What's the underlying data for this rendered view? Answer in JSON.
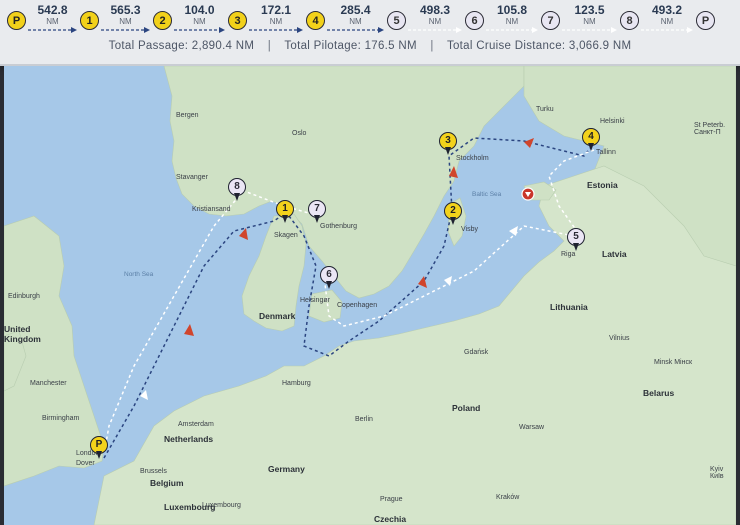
{
  "itinerary": {
    "stops": [
      {
        "label": "P",
        "kind": "pilot"
      },
      {
        "label": "1",
        "kind": "pilot"
      },
      {
        "label": "2",
        "kind": "pilot"
      },
      {
        "label": "3",
        "kind": "pilot"
      },
      {
        "label": "4",
        "kind": "pilot"
      },
      {
        "label": "5",
        "kind": "cruise"
      },
      {
        "label": "6",
        "kind": "cruise"
      },
      {
        "label": "7",
        "kind": "cruise"
      },
      {
        "label": "8",
        "kind": "cruise"
      },
      {
        "label": "P",
        "kind": "cruise"
      }
    ],
    "legs": [
      {
        "distance": "542.8",
        "unit": "NM",
        "kind": "pilotage"
      },
      {
        "distance": "565.3",
        "unit": "NM",
        "kind": "pilotage"
      },
      {
        "distance": "104.0",
        "unit": "NM",
        "kind": "pilotage"
      },
      {
        "distance": "172.1",
        "unit": "NM",
        "kind": "pilotage"
      },
      {
        "distance": "285.4",
        "unit": "NM",
        "kind": "pilotage"
      },
      {
        "distance": "498.3",
        "unit": "NM",
        "kind": "cruise"
      },
      {
        "distance": "105.8",
        "unit": "NM",
        "kind": "cruise"
      },
      {
        "distance": "123.5",
        "unit": "NM",
        "kind": "cruise"
      },
      {
        "distance": "493.2",
        "unit": "NM",
        "kind": "cruise"
      }
    ]
  },
  "totals": {
    "passage": "Total Passage: 2,890.4 NM",
    "pilotage": "Total Pilotage: 176.5 NM",
    "cruise": "Total Cruise Distance: 3,066.9 NM",
    "separator": "|"
  },
  "colors": {
    "pilot_accent": "#f3d21b",
    "cruise_accent": "#ebe6f5",
    "route_dark": "#2b4580",
    "route_light": "#ffffff",
    "sea": "#a6c8e8",
    "land": "#cfe1c5",
    "direction_marker": "#d0452c"
  },
  "map": {
    "markers": [
      {
        "label": "P",
        "kind": "pilot",
        "name": "Dover"
      },
      {
        "label": "1",
        "kind": "pilot",
        "name": "Skagen"
      },
      {
        "label": "2",
        "kind": "pilot",
        "name": "Visby"
      },
      {
        "label": "3",
        "kind": "pilot",
        "name": "Stockholm"
      },
      {
        "label": "4",
        "kind": "pilot",
        "name": "Tallinn"
      },
      {
        "label": "5",
        "kind": "cruise",
        "name": "Riga"
      },
      {
        "label": "6",
        "kind": "cruise",
        "name": "Copenhagen"
      },
      {
        "label": "7",
        "kind": "cruise",
        "name": "Gothenburg"
      },
      {
        "label": "8",
        "kind": "cruise",
        "name": "Kristiansand"
      }
    ],
    "countries": [
      "Denmark",
      "Estonia",
      "Latvia",
      "Lithuania",
      "Poland",
      "Belarus",
      "Germany",
      "Netherlands",
      "Belgium",
      "Luxembourg",
      "Czechia",
      "United Kingdom"
    ],
    "cities": [
      "Bergen",
      "Oslo",
      "Turku",
      "Helsinki",
      "St Peterb. Санкт-П",
      "Stavanger",
      "Kristiansand",
      "Skagen",
      "Gothenburg",
      "Stockholm",
      "Tallinn",
      "Visby",
      "Riga",
      "Helsingør",
      "Copenhagen",
      "Edinburgh",
      "Manchester",
      "Birmingham",
      "London",
      "Dover",
      "Amsterdam",
      "Brussels",
      "Hamburg",
      "Berlin",
      "Gdańsk",
      "Vilnius",
      "Minsk Мінск",
      "Warsaw",
      "Prague",
      "Kraków",
      "Kyiv Київ",
      "Luxembourg"
    ],
    "seas": [
      "North Sea",
      "Baltic Sea"
    ]
  }
}
